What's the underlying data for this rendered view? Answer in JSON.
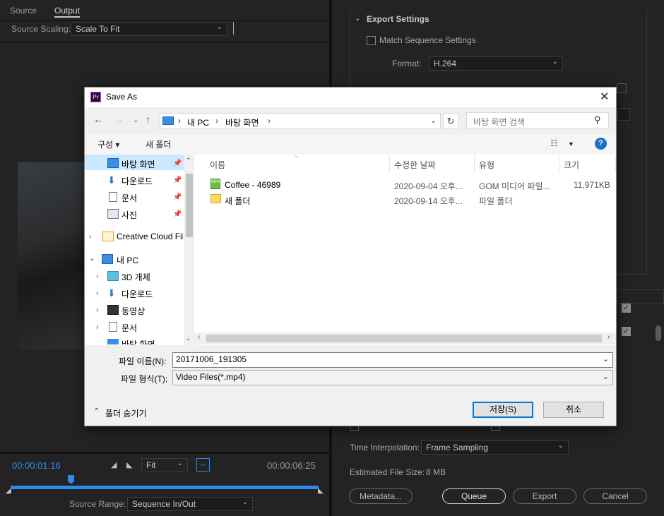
{
  "left_panel": {
    "tabs": [
      "Source",
      "Output"
    ],
    "source_scaling_label": "Source Scaling:",
    "source_scaling_value": "Scale To Fit",
    "timecode_current": "00:00:01:16",
    "timecode_end": "00:00:06:25",
    "zoom_value": "Fit",
    "source_range_label": "Source Range:",
    "source_range_value": "Sequence In/Out"
  },
  "right_panel": {
    "section_title": "Export Settings",
    "match_sequence_label": "Match Sequence Settings",
    "format_label": "Format:",
    "format_value": "H.264",
    "time_interpolation_label": "Time Interpolation:",
    "time_interpolation_value": "Frame Sampling",
    "file_size_label": "Estimated File Size:",
    "file_size_value": "8 MB",
    "buttons": {
      "metadata": "Metadata...",
      "queue": "Queue",
      "export": "Export",
      "cancel": "Cancel"
    }
  },
  "dialog": {
    "title": "Save As",
    "breadcrumb": [
      "내 PC",
      "바탕 화면"
    ],
    "search_placeholder": "바탕 화면 검색",
    "toolbar": {
      "organize": "구성 ▾",
      "new_folder": "새 폴더"
    },
    "nav_items": [
      {
        "label": "바탕 화면"
      },
      {
        "label": "다운로드"
      },
      {
        "label": "문서"
      },
      {
        "label": "사진"
      },
      {
        "label": "Creative Cloud Fil"
      },
      {
        "label": "내 PC"
      },
      {
        "label": "3D 개체"
      },
      {
        "label": "다운로드"
      },
      {
        "label": "동영상"
      },
      {
        "label": "문서"
      },
      {
        "label": "바탕 화면"
      }
    ],
    "columns": [
      "이름",
      "수정한 날짜",
      "유형",
      "크기"
    ],
    "files": [
      {
        "name": "Coffee - 46989",
        "date": "2020-09-04 오후...",
        "type": "GOM 미디어 파일...",
        "size": "11,971KB"
      },
      {
        "name": "새 폴더",
        "date": "2020-09-14 오후...",
        "type": "파일 폴더",
        "size": ""
      }
    ],
    "filename_label": "파일 이름(N):",
    "filename_value": "20171006_191305",
    "filetype_label": "파일 형식(T):",
    "filetype_value": "Video Files(*.mp4)",
    "hide_folders_label": "폴더 숨기기",
    "save_button": "저장(S)",
    "cancel_button": "취소"
  }
}
